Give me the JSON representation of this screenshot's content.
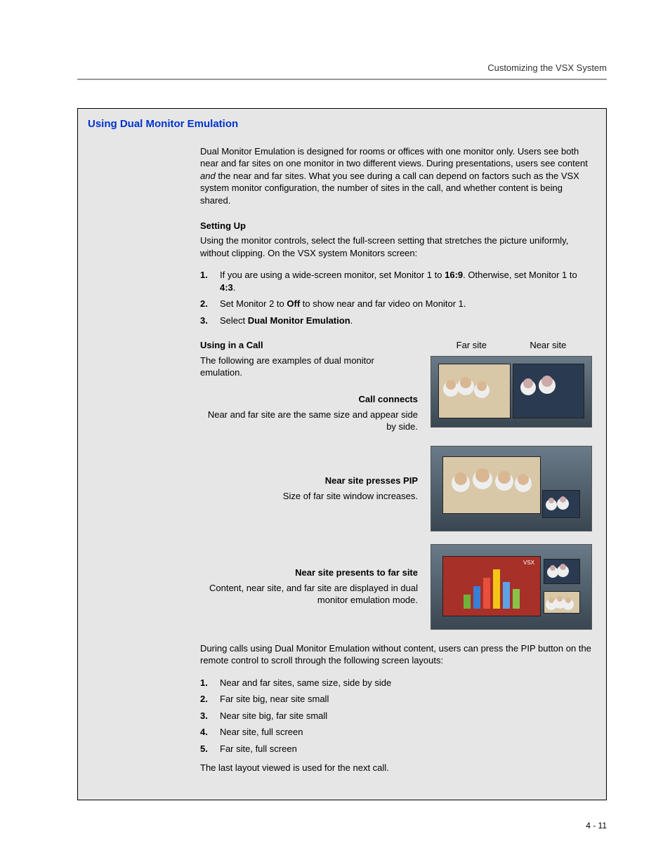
{
  "runningHead": "Customizing the VSX System",
  "sectionTitle": "Using Dual Monitor Emulation",
  "intro": {
    "pre": "Dual Monitor Emulation is designed for rooms or offices with one monitor only. Users see both near and far sites on one monitor in two different views. During presentations, users see content ",
    "italic": "and",
    "post": " the near and far sites. What you see during a call can depend on factors such as the VSX system monitor configuration, the number of sites in the call, and whether content is being shared."
  },
  "setup": {
    "heading": "Setting Up",
    "lead": "Using the monitor controls, select the full-screen setting that stretches the picture uniformly, without clipping. On the VSX system Monitors screen:",
    "steps": [
      {
        "n": "1.",
        "pre": "If you are using a wide-screen monitor, set Monitor 1 to ",
        "b1": "16:9",
        "mid": ". Otherwise, set Monitor 1 to ",
        "b2": "4:3",
        "post": "."
      },
      {
        "n": "2.",
        "pre": "Set Monitor 2 to ",
        "b1": "Off",
        "mid": " to show near and far video on Monitor 1.",
        "b2": "",
        "post": ""
      },
      {
        "n": "3.",
        "pre": "Select ",
        "b1": "Dual Monitor Emulation",
        "mid": ".",
        "b2": "",
        "post": ""
      }
    ]
  },
  "usingCall": {
    "heading": "Using in a Call",
    "lead": "The following are examples of dual monitor emulation.",
    "farLabel": "Far site",
    "nearLabel": "Near site"
  },
  "ex1": {
    "title": "Call connects",
    "desc": "Near and far site are the same size and appear side by side."
  },
  "ex2": {
    "title": "Near site presses PIP",
    "desc": "Size of far site window increases."
  },
  "ex3": {
    "title": "Near site presents to far site",
    "desc": "Content, near site, and far site are displayed in dual monitor emulation mode."
  },
  "layouts": {
    "lead": "During calls using Dual Monitor Emulation without content, users can press the PIP button on the remote control to scroll through the following screen layouts:",
    "items": [
      {
        "n": "1.",
        "t": "Near and far sites, same size, side by side"
      },
      {
        "n": "2.",
        "t": "Far site big, near site small"
      },
      {
        "n": "3.",
        "t": "Near site big, far site small"
      },
      {
        "n": "4.",
        "t": "Near site, full screen"
      },
      {
        "n": "5.",
        "t": "Far site, full screen"
      }
    ],
    "trail": "The last layout viewed is used for the next call."
  },
  "pageNum": "4 - 11",
  "vsx": "VSX"
}
